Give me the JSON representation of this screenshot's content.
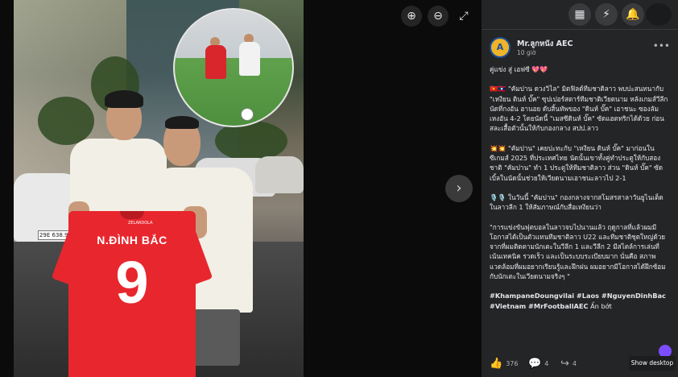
{
  "viewer": {
    "zoom_in_icon": "⊕",
    "zoom_out_icon": "⊖",
    "fullscreen_icon": "⤢",
    "next_icon": "›",
    "jersey": {
      "brand": "ZELARDOLA",
      "player_name": "N.ĐÌNH BẮC",
      "number": "9"
    },
    "plate": "29E 638.94"
  },
  "topbar": {
    "menu_icon": "▦",
    "messenger_icon": "⚡",
    "notifications_icon": "🔔"
  },
  "post": {
    "author": "Mr.ลูกหนัง AEC",
    "time": "10 giờ",
    "more_icon": "•••",
    "avatar_letter": "A",
    "paragraphs": [
      "คู่แข่ง สู่ เอฟซี 💖💖",
      "🇻🇳🇱🇦 \"คัมปาน ดวงวิไล\" มิดฟิลด์ทีมชาติลาว พบปะสนทนากับ \"เหงียน ดินห์ บั๊ค\" ซุปเปอร์สตาร์ทีมชาติเวียดนาม หลังเกมส์วีลีก นัดที่กงอัน ฮานอย ดับสิ้นทัพของ \"ดินห์ บั๊ค\" เอาชนะ ซองลัม เหงอัน 4-2 โดยนัดนี้ \"เมสซีดินห์ บั๊ค\" ซัดแฮตทริกได้ด้วย ก่อนสละเสื้อตัวนั้นให้กับกองกลาง สปป.ลาว",
      "💥💥 \"คัมปาน\" เคยปะทะกับ \"เหงียน ดินห์ บั๊ค\" มาก่อนในซีเกมส์ 2025 ที่ประเทศไทย นัดนั้นเขาทั้งคู่ทำประตูให้กับสองชาติ \"คัมปาน\" ทำ 1 ประตูให้ทีมชาติลาว ส่วน \"ดินห์ บั๊ค\" ซัดเบิ้ลในนัดนั้นช่วยให้เวียดนามเอาชนะลาวไป 2-1",
      "🎙️🎙️ ในวันนี้ \"คัมปาน\" กองกลางจากสโมสรสาลาวันยูไนเต็ด ในลาวลีก 1 ให้สัมภาษณ์กับสื่อเหงียนว่า",
      "\"การแข่งขันฟุตบอลในลาวจบไปนานแล้ว ฤดูกาลที่แล้วผมมีโอกาสได้เป็นตัวแทนทีมชาติลาว U22 และทีมชาติชุดใหญ่ด้วย จากที่ผมติดตามนักเตะในวีลีก 1 และวีลีก 2 มีสไตล์การเล่นที่เน้นเทคนิค รวดเร็ว และเป็นระบบระเบียบมาก นั่นคือ สภาพแวดล้อมที่ผมอยากเรียนรู้และฝึกฝน ผมอยากมีโอกาสได้ฝึกซ้อมกับนักเตะในเวียดนามจริงๆ \""
    ],
    "hashtags": "#KhampaneDoungvilai #Laos #NguyenDinhBac #Vietnam #MrFootballAEC",
    "hide": "Ẩn bớt"
  },
  "actions": {
    "like_icon": "👍",
    "like_count": "376",
    "comment_icon": "💬",
    "comment_count": "4",
    "share_icon": "↪",
    "share_count": "4"
  },
  "show_desktop": "Show desktop"
}
